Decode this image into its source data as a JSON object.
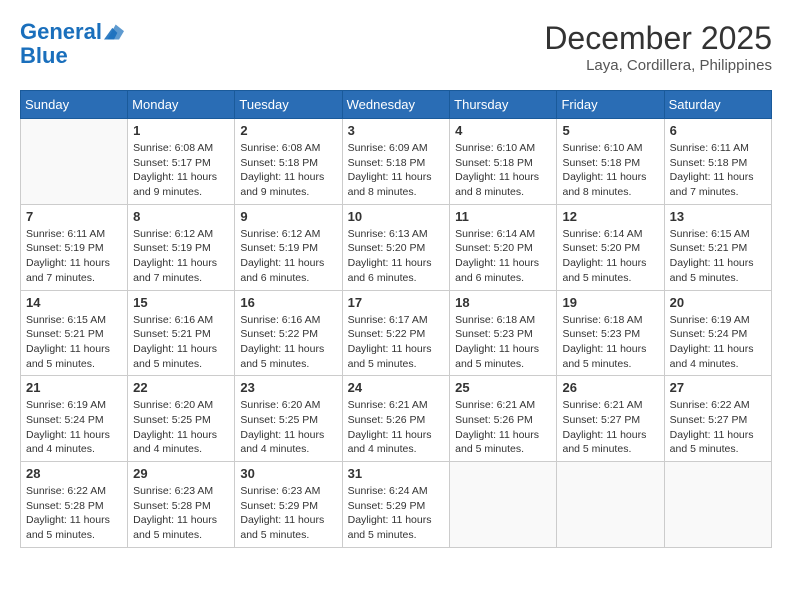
{
  "header": {
    "logo_line1": "General",
    "logo_line2": "Blue",
    "month": "December 2025",
    "location": "Laya, Cordillera, Philippines"
  },
  "weekdays": [
    "Sunday",
    "Monday",
    "Tuesday",
    "Wednesday",
    "Thursday",
    "Friday",
    "Saturday"
  ],
  "weeks": [
    [
      {
        "day": "",
        "sunrise": "",
        "sunset": "",
        "daylight": ""
      },
      {
        "day": "1",
        "sunrise": "6:08 AM",
        "sunset": "5:17 PM",
        "daylight": "11 hours and 9 minutes."
      },
      {
        "day": "2",
        "sunrise": "6:08 AM",
        "sunset": "5:18 PM",
        "daylight": "11 hours and 9 minutes."
      },
      {
        "day": "3",
        "sunrise": "6:09 AM",
        "sunset": "5:18 PM",
        "daylight": "11 hours and 8 minutes."
      },
      {
        "day": "4",
        "sunrise": "6:10 AM",
        "sunset": "5:18 PM",
        "daylight": "11 hours and 8 minutes."
      },
      {
        "day": "5",
        "sunrise": "6:10 AM",
        "sunset": "5:18 PM",
        "daylight": "11 hours and 8 minutes."
      },
      {
        "day": "6",
        "sunrise": "6:11 AM",
        "sunset": "5:18 PM",
        "daylight": "11 hours and 7 minutes."
      }
    ],
    [
      {
        "day": "7",
        "sunrise": "6:11 AM",
        "sunset": "5:19 PM",
        "daylight": "11 hours and 7 minutes."
      },
      {
        "day": "8",
        "sunrise": "6:12 AM",
        "sunset": "5:19 PM",
        "daylight": "11 hours and 7 minutes."
      },
      {
        "day": "9",
        "sunrise": "6:12 AM",
        "sunset": "5:19 PM",
        "daylight": "11 hours and 6 minutes."
      },
      {
        "day": "10",
        "sunrise": "6:13 AM",
        "sunset": "5:20 PM",
        "daylight": "11 hours and 6 minutes."
      },
      {
        "day": "11",
        "sunrise": "6:14 AM",
        "sunset": "5:20 PM",
        "daylight": "11 hours and 6 minutes."
      },
      {
        "day": "12",
        "sunrise": "6:14 AM",
        "sunset": "5:20 PM",
        "daylight": "11 hours and 5 minutes."
      },
      {
        "day": "13",
        "sunrise": "6:15 AM",
        "sunset": "5:21 PM",
        "daylight": "11 hours and 5 minutes."
      }
    ],
    [
      {
        "day": "14",
        "sunrise": "6:15 AM",
        "sunset": "5:21 PM",
        "daylight": "11 hours and 5 minutes."
      },
      {
        "day": "15",
        "sunrise": "6:16 AM",
        "sunset": "5:21 PM",
        "daylight": "11 hours and 5 minutes."
      },
      {
        "day": "16",
        "sunrise": "6:16 AM",
        "sunset": "5:22 PM",
        "daylight": "11 hours and 5 minutes."
      },
      {
        "day": "17",
        "sunrise": "6:17 AM",
        "sunset": "5:22 PM",
        "daylight": "11 hours and 5 minutes."
      },
      {
        "day": "18",
        "sunrise": "6:18 AM",
        "sunset": "5:23 PM",
        "daylight": "11 hours and 5 minutes."
      },
      {
        "day": "19",
        "sunrise": "6:18 AM",
        "sunset": "5:23 PM",
        "daylight": "11 hours and 5 minutes."
      },
      {
        "day": "20",
        "sunrise": "6:19 AM",
        "sunset": "5:24 PM",
        "daylight": "11 hours and 4 minutes."
      }
    ],
    [
      {
        "day": "21",
        "sunrise": "6:19 AM",
        "sunset": "5:24 PM",
        "daylight": "11 hours and 4 minutes."
      },
      {
        "day": "22",
        "sunrise": "6:20 AM",
        "sunset": "5:25 PM",
        "daylight": "11 hours and 4 minutes."
      },
      {
        "day": "23",
        "sunrise": "6:20 AM",
        "sunset": "5:25 PM",
        "daylight": "11 hours and 4 minutes."
      },
      {
        "day": "24",
        "sunrise": "6:21 AM",
        "sunset": "5:26 PM",
        "daylight": "11 hours and 4 minutes."
      },
      {
        "day": "25",
        "sunrise": "6:21 AM",
        "sunset": "5:26 PM",
        "daylight": "11 hours and 5 minutes."
      },
      {
        "day": "26",
        "sunrise": "6:21 AM",
        "sunset": "5:27 PM",
        "daylight": "11 hours and 5 minutes."
      },
      {
        "day": "27",
        "sunrise": "6:22 AM",
        "sunset": "5:27 PM",
        "daylight": "11 hours and 5 minutes."
      }
    ],
    [
      {
        "day": "28",
        "sunrise": "6:22 AM",
        "sunset": "5:28 PM",
        "daylight": "11 hours and 5 minutes."
      },
      {
        "day": "29",
        "sunrise": "6:23 AM",
        "sunset": "5:28 PM",
        "daylight": "11 hours and 5 minutes."
      },
      {
        "day": "30",
        "sunrise": "6:23 AM",
        "sunset": "5:29 PM",
        "daylight": "11 hours and 5 minutes."
      },
      {
        "day": "31",
        "sunrise": "6:24 AM",
        "sunset": "5:29 PM",
        "daylight": "11 hours and 5 minutes."
      },
      {
        "day": "",
        "sunrise": "",
        "sunset": "",
        "daylight": ""
      },
      {
        "day": "",
        "sunrise": "",
        "sunset": "",
        "daylight": ""
      },
      {
        "day": "",
        "sunrise": "",
        "sunset": "",
        "daylight": ""
      }
    ]
  ]
}
